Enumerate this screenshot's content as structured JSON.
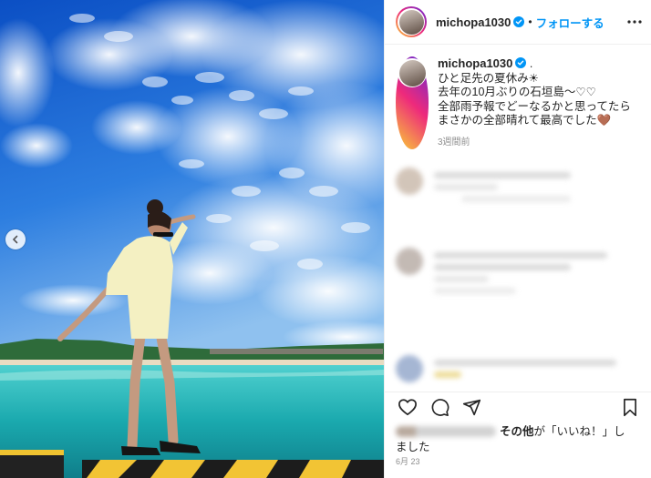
{
  "post": {
    "username": "michopa1030",
    "follow_label": "フォローする",
    "separator": "•",
    "caption_username": "michopa1030",
    "caption_suffix": ".",
    "caption_lines": [
      "ひと足先の夏休み☀",
      "去年の10月ぶりの石垣島〜♡♡",
      "全部雨予報でどーなるかと思ってたら",
      "まさかの全部晴れて最高でした🤎"
    ],
    "caption_time": "3週間前",
    "likes_prefix": "その他",
    "likes_suffix": "が「いいね！」しました",
    "likes_wrap": "ました",
    "likes_main": "が「いいね！」し",
    "date": "6月 23"
  },
  "icons": {
    "verified": "verified-badge-icon",
    "more": "more-options-icon",
    "like": "heart-icon",
    "comment": "comment-icon",
    "share": "share-icon",
    "save": "bookmark-icon",
    "prev": "chevron-left-icon"
  },
  "colors": {
    "accent": "#0095f6",
    "text": "#262626",
    "muted": "#8e8e8e"
  }
}
